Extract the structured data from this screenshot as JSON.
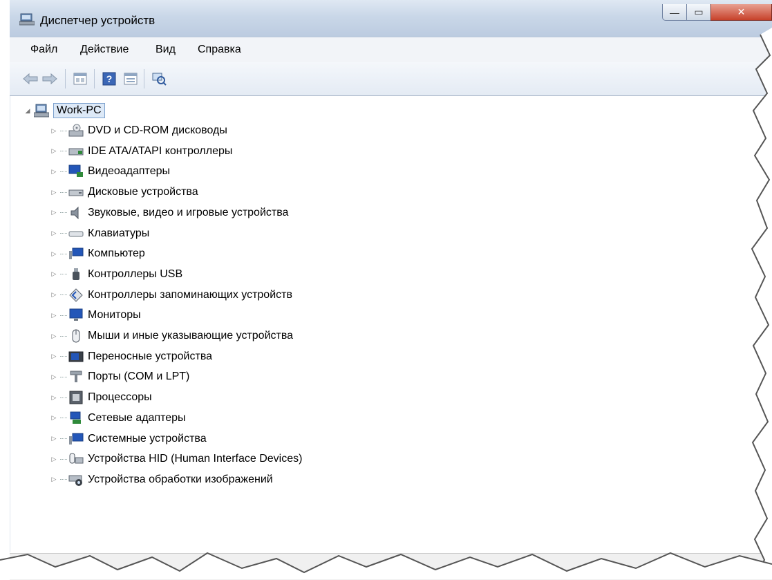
{
  "window": {
    "title": "Диспетчер устройств",
    "minimize_glyph": "—",
    "maximize_glyph": "▭",
    "close_glyph": "✕"
  },
  "menu": {
    "file": "Файл",
    "action": "Действие",
    "view": "Вид",
    "help": "Справка"
  },
  "toolbar": {
    "buttons": [
      "back-icon",
      "forward-icon",
      "properties-pane-icon",
      "help-icon",
      "console-tree-icon",
      "scan-hardware-icon"
    ]
  },
  "tree": {
    "root": "Work-PC",
    "items": [
      {
        "label": "DVD и CD-ROM дисководы",
        "icon": "dvd-drive-icon"
      },
      {
        "label": "IDE ATA/ATAPI контроллеры",
        "icon": "ide-controller-icon"
      },
      {
        "label": "Видеоадаптеры",
        "icon": "display-adapter-icon"
      },
      {
        "label": "Дисковые устройства",
        "icon": "disk-drive-icon"
      },
      {
        "label": "Звуковые, видео и игровые устройства",
        "icon": "speaker-icon"
      },
      {
        "label": "Клавиатуры",
        "icon": "keyboard-icon"
      },
      {
        "label": "Компьютер",
        "icon": "computer-icon"
      },
      {
        "label": "Контроллеры USB",
        "icon": "usb-icon"
      },
      {
        "label": "Контроллеры запоминающих устройств",
        "icon": "storage-controller-icon"
      },
      {
        "label": "Мониторы",
        "icon": "monitor-icon"
      },
      {
        "label": "Мыши и иные указывающие устройства",
        "icon": "mouse-icon"
      },
      {
        "label": "Переносные устройства",
        "icon": "portable-device-icon"
      },
      {
        "label": "Порты (COM и LPT)",
        "icon": "port-icon"
      },
      {
        "label": "Процессоры",
        "icon": "processor-icon"
      },
      {
        "label": "Сетевые адаптеры",
        "icon": "network-adapter-icon"
      },
      {
        "label": "Системные устройства",
        "icon": "system-device-icon"
      },
      {
        "label": "Устройства HID (Human Interface Devices)",
        "icon": "hid-icon"
      },
      {
        "label": "Устройства обработки изображений",
        "icon": "imaging-device-icon"
      }
    ]
  },
  "colors": {
    "titlebar": "#c9d7e8",
    "close_button": "#c7412a",
    "selection_border": "#7da2ce"
  }
}
